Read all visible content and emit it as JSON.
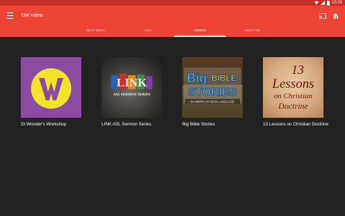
{
  "status": {
    "time": "10:26"
  },
  "app": {
    "title": "DM Video"
  },
  "tabs": [
    {
      "label": "DEAF DEVO"
    },
    {
      "label": "ASLV"
    },
    {
      "label": "VIDEOS"
    },
    {
      "label": "ABOUT US"
    }
  ],
  "active_tab": "VIDEOS",
  "videos": [
    {
      "title": "Dr.Wonder's Workshop",
      "logo_text": "W"
    },
    {
      "title": "LINK ASL Sermon Series",
      "logo_text": "LINK",
      "logo_subtext": "ASL SERMON SERIES"
    },
    {
      "title": "Big Bible Stories",
      "logo_text_1": "Big",
      "logo_text_2": "BIBLE",
      "logo_text_3": "STORIES",
      "logo_subtext": "IN AMERICAN SIGN LANGUAGE"
    },
    {
      "title": "13 Lessons on Christian Doctrine",
      "logo_text_1": "13",
      "logo_text_2": "Lessons",
      "logo_text_3": "on Christian",
      "logo_text_4": "Doctrine"
    }
  ],
  "colors": {
    "status_bar": "#c62f25",
    "app_bar": "#ee4436",
    "background": "#222222",
    "accent_yellow": "#f2e42c",
    "purple": "#8a4ba1"
  }
}
